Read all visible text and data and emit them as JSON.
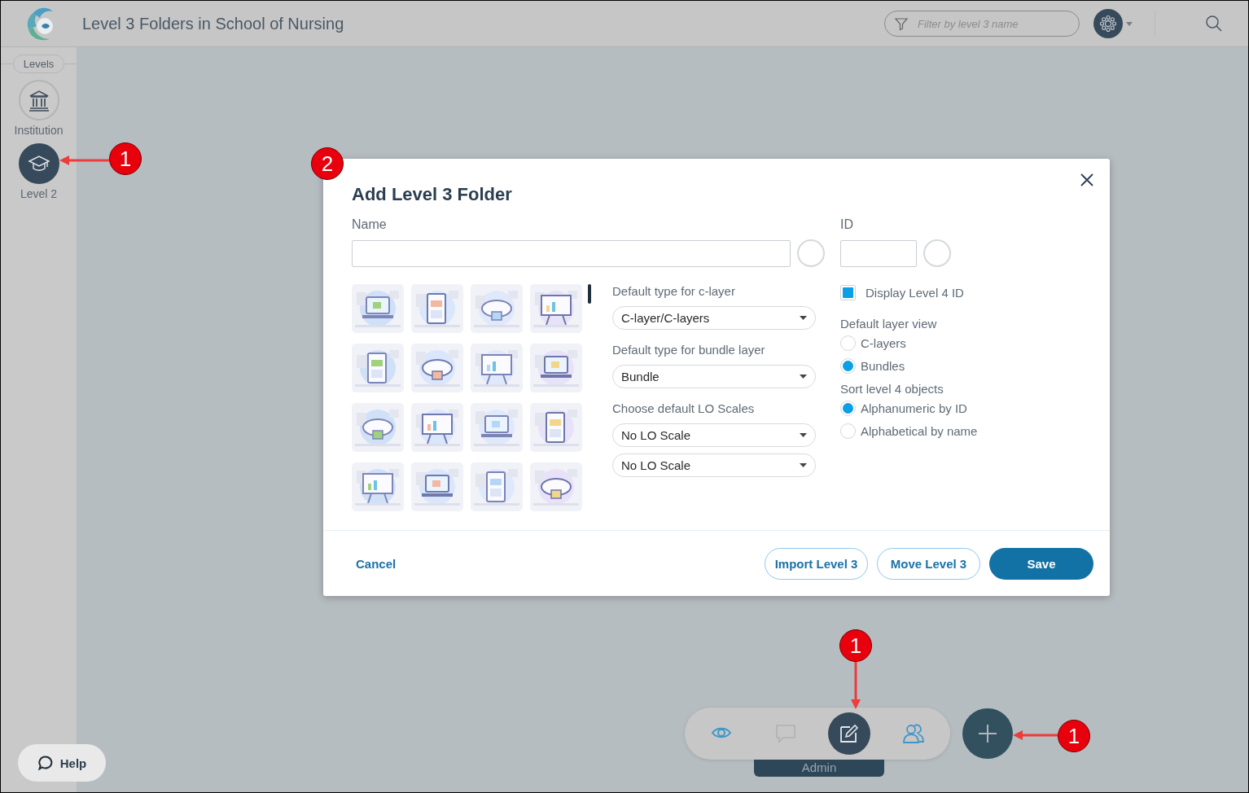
{
  "header": {
    "title": "Level 3 Folders in School of Nursing",
    "filter": {
      "placeholder": "Filter by level 3 name"
    }
  },
  "sidebar": {
    "heading": "Levels",
    "items": [
      {
        "label": "Institution",
        "kind": "institution",
        "selected": false
      },
      {
        "label": "Level 2",
        "kind": "cap",
        "selected": true
      }
    ]
  },
  "dialog": {
    "title": "Add Level 3 Folder",
    "name": {
      "label": "Name"
    },
    "id": {
      "label": "ID"
    },
    "selects": [
      {
        "label": "Default type for c-layer",
        "values": [
          "C-layer/C-layers"
        ]
      },
      {
        "label": "Default type for bundle layer",
        "values": [
          "Bundle"
        ]
      },
      {
        "label": "Choose default LO Scales",
        "values": [
          "No LO Scale",
          "No LO Scale"
        ]
      }
    ],
    "display_id": {
      "label": "Display Level 4 ID",
      "checked": true
    },
    "radio_groups": [
      {
        "label": "Default layer view",
        "options": [
          {
            "label": "C-layers",
            "selected": false
          },
          {
            "label": "Bundles",
            "selected": true
          }
        ]
      },
      {
        "label": "Sort level 4 objects",
        "options": [
          {
            "label": "Alphanumeric by ID",
            "selected": true
          },
          {
            "label": "Alphabetical by name",
            "selected": false
          }
        ]
      }
    ],
    "cancel": "Cancel",
    "buttons": [
      {
        "label": "Import Level 3",
        "kind": "outline"
      },
      {
        "label": "Move Level 3",
        "kind": "outline"
      },
      {
        "label": "Save",
        "kind": "primary"
      }
    ]
  },
  "dock": {
    "items": [
      {
        "kind": "eye",
        "selected": false,
        "disabled": false
      },
      {
        "kind": "comment",
        "selected": false,
        "disabled": true
      },
      {
        "kind": "edit",
        "selected": true,
        "disabled": false
      },
      {
        "kind": "users",
        "selected": false,
        "disabled": false
      }
    ],
    "active_label": "Admin"
  },
  "help": "Help",
  "annotations": [
    {
      "label": "1",
      "kind": "arrow_left"
    },
    {
      "label": "2",
      "kind": "plain"
    },
    {
      "label": "1",
      "kind": "arrow_down"
    },
    {
      "label": "1",
      "kind": "arrow_left"
    }
  ]
}
